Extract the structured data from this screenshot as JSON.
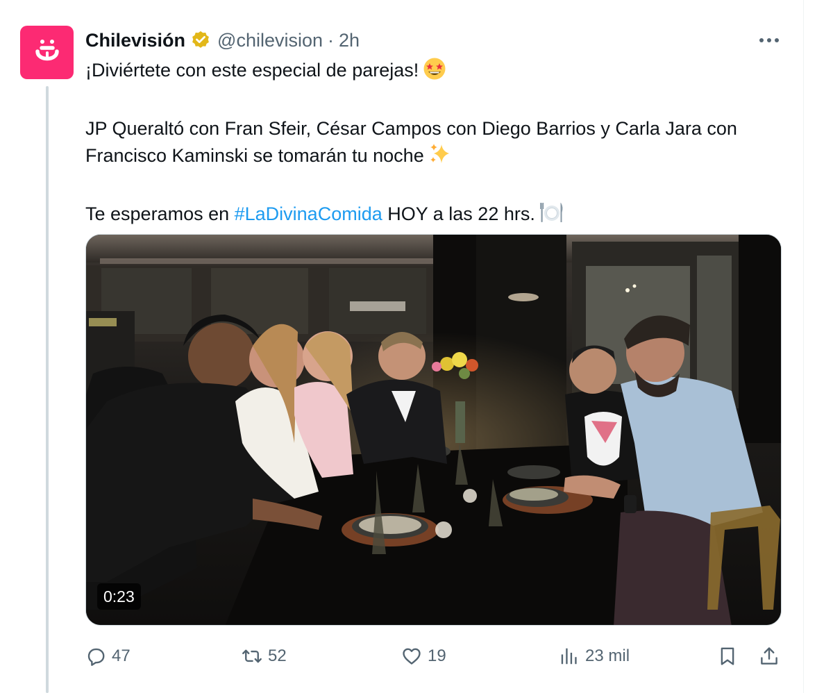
{
  "tweet": {
    "author": {
      "display_name": "Chilevisión",
      "handle": "@chilevision",
      "separator": "·",
      "time": "2h",
      "verified_icon": "verified-gold-badge-icon",
      "avatar_icon": "chilevision-logo-icon",
      "avatar_color": "#fc2a73"
    },
    "text": {
      "line1": "¡Diviértete con este especial de parejas!",
      "line1_emoji": "star-struck-emoji",
      "paragraph2": "JP Queraltó con Fran Sfeir, César Campos con Diego Barrios y Carla Jara con Francisco Kaminski se tomarán tu noche",
      "paragraph2_emoji": "sparkles-emoji",
      "paragraph3_before": "Te esperamos en ",
      "hashtag": "#LaDivinaComida",
      "paragraph3_after": " HOY a las 22 hrs.",
      "paragraph3_emoji": "fork-knife-plate-emoji"
    },
    "media": {
      "type": "video",
      "duration": "0:23"
    },
    "actions": {
      "replies": "47",
      "reposts": "52",
      "likes": "19",
      "views": "23 mil"
    },
    "more_icon": "more-horizontal-icon",
    "colors": {
      "link": "#1d9bf0",
      "secondary_text": "#536471",
      "verified_gold": "#e2b719"
    }
  }
}
